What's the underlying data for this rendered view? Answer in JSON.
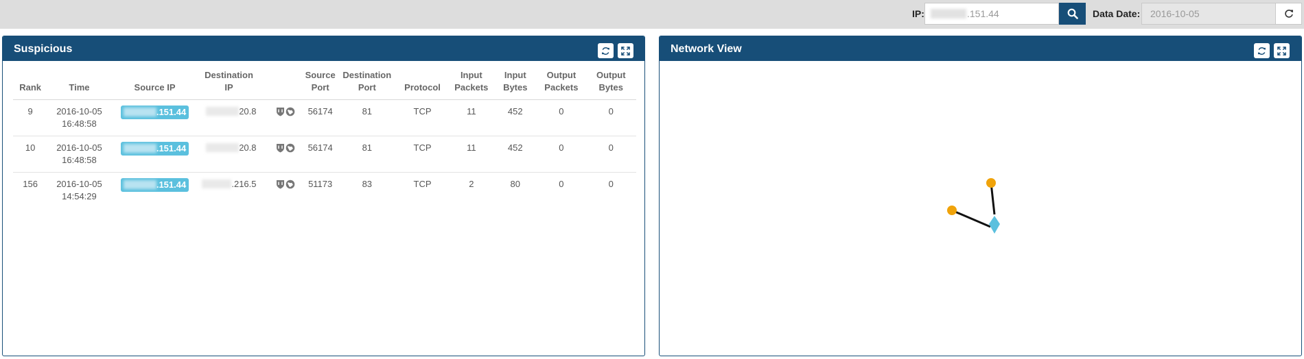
{
  "topbar": {
    "ip_label": "IP:",
    "ip_value_suffix": ".151.44",
    "date_label": "Data Date:",
    "date_value": "2016-10-05",
    "search_icon": "search-icon",
    "refresh_icon": "refresh-icon"
  },
  "suspicious": {
    "title": "Suspicious",
    "refresh_icon": "refresh-icon",
    "expand_icon": "expand-icon",
    "columns": [
      [
        "Rank"
      ],
      [
        "Time"
      ],
      [
        "Source IP"
      ],
      [
        "Destination",
        "IP"
      ],
      [
        ""
      ],
      [
        "Source",
        "Port"
      ],
      [
        "Destination",
        "Port"
      ],
      [
        "Protocol"
      ],
      [
        "Input",
        "Packets"
      ],
      [
        "Input",
        "Bytes"
      ],
      [
        "Output",
        "Packets"
      ],
      [
        "Output",
        "Bytes"
      ]
    ],
    "rows": [
      {
        "rank": "9",
        "date": "2016-10-05",
        "time": "16:48:58",
        "src_suffix": ".151.44",
        "dst_suffix": "20.8",
        "src_port": "56174",
        "dst_port": "81",
        "protocol": "TCP",
        "in_packets": "11",
        "in_bytes": "452",
        "out_packets": "0",
        "out_bytes": "0"
      },
      {
        "rank": "10",
        "date": "2016-10-05",
        "time": "16:48:58",
        "src_suffix": ".151.44",
        "dst_suffix": "20.8",
        "src_port": "56174",
        "dst_port": "81",
        "protocol": "TCP",
        "in_packets": "11",
        "in_bytes": "452",
        "out_packets": "0",
        "out_bytes": "0"
      },
      {
        "rank": "156",
        "date": "2016-10-05",
        "time": "14:54:29",
        "src_suffix": ".151.44",
        "dst_suffix": ".216.5",
        "src_port": "51173",
        "dst_port": "83",
        "protocol": "TCP",
        "in_packets": "2",
        "in_bytes": "80",
        "out_packets": "0",
        "out_bytes": "0"
      }
    ],
    "row_icons": [
      "shield-icon",
      "globe-icon"
    ]
  },
  "network": {
    "title": "Network View",
    "refresh_icon": "refresh-icon",
    "expand_icon": "expand-icon",
    "colors": {
      "node": "#f0a30a",
      "center": "#5bc0de",
      "edge": "#111111"
    }
  }
}
